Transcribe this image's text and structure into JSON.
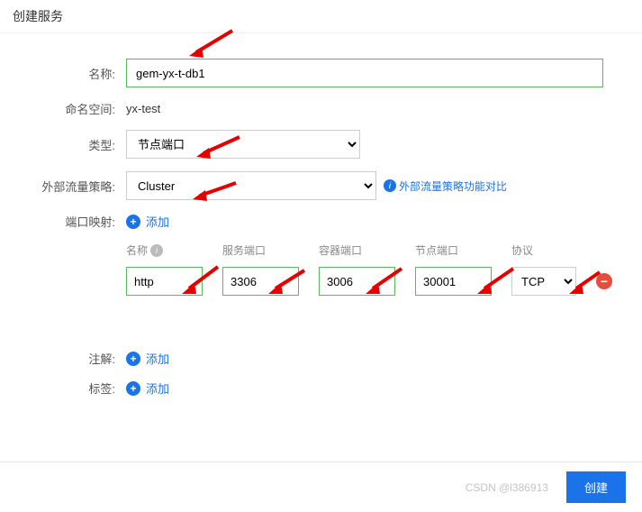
{
  "title": "创建服务",
  "form": {
    "name_label": "名称:",
    "name_value": "gem-yx-t-db1",
    "namespace_label": "命名空间:",
    "namespace_value": "yx-test",
    "type_label": "类型:",
    "type_value": "节点端口",
    "policy_label": "外部流量策略:",
    "policy_value": "Cluster",
    "policy_link_text": "外部流量策略功能对比",
    "port_label": "端口映射:",
    "add_text": "添加",
    "annotation_label": "注解:",
    "tag_label": "标签:"
  },
  "port_table": {
    "headers": {
      "name": "名称",
      "service_port": "服务端口",
      "container_port": "容器端口",
      "node_port": "节点端口",
      "protocol": "协议"
    },
    "row": {
      "name": "http",
      "service_port": "3306",
      "container_port": "3006",
      "node_port": "30001",
      "protocol": "TCP"
    }
  },
  "footer": {
    "watermark": "CSDN @l386913",
    "create_btn": "创建"
  }
}
